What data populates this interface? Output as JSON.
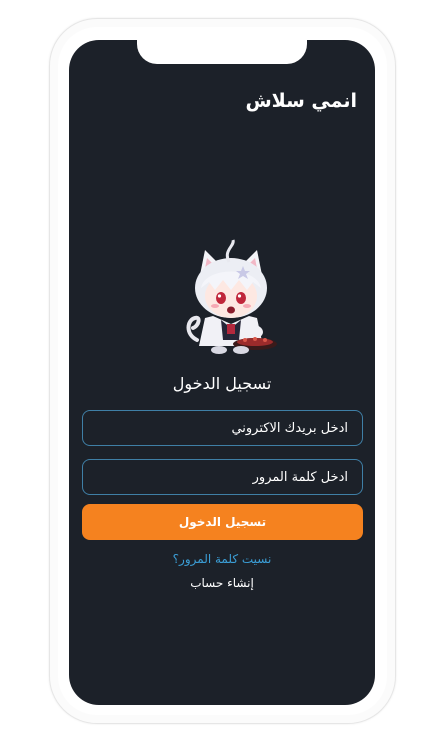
{
  "app": {
    "title": "انمي سلاش"
  },
  "login": {
    "heading": "تسجيل الدخول",
    "email_placeholder": "ادخل بريدك الاكتروني",
    "password_placeholder": "ادخل كلمة المرور",
    "submit_label": "تسجيل الدخول",
    "forgot_password": "نسيت كلمة المرور؟",
    "create_account": "إنشاء حساب"
  },
  "colors": {
    "background": "#1c2129",
    "accent": "#f5821f",
    "input_border": "#3f7fa6",
    "link": "#3b9ed6"
  },
  "icons": {
    "mascot": "anime-cat-boy-mascot"
  }
}
